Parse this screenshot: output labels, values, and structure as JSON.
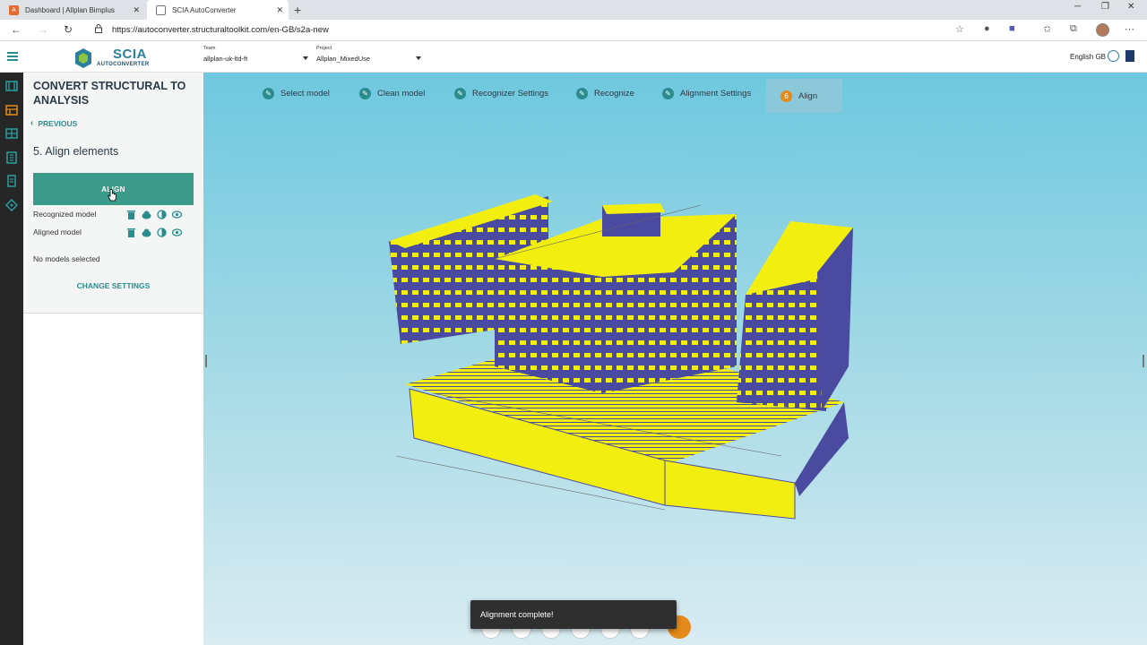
{
  "browser": {
    "tabs": [
      {
        "title": "Dashboard | Allplan Bimplus",
        "favicon": "A"
      },
      {
        "title": "SCIA AutoConverter"
      }
    ],
    "url": "https://autoconverter.structuraltoolkit.com/en-GB/s2a-new"
  },
  "header": {
    "logo_text": "SCIA",
    "logo_sub": "AUTOCONVERTER",
    "team_label": "Team",
    "team_value": "allplan-uk-ltd-ft",
    "project_label": "Project",
    "project_value": "Allplan_MixedUse",
    "language": "English GB"
  },
  "panel": {
    "title": "CONVERT STRUCTURAL TO ANALYSIS",
    "previous_label": "PREVIOUS",
    "step_title": "5.  Align elements",
    "align_button": "ALIGN",
    "models": [
      {
        "label": "Recognized model"
      },
      {
        "label": "Aligned model"
      }
    ],
    "no_models": "No models selected",
    "change_settings": "CHANGE SETTINGS"
  },
  "stepper": {
    "steps": [
      {
        "label": "Select model",
        "state": "done"
      },
      {
        "label": "Clean model",
        "state": "done"
      },
      {
        "label": "Recognizer Settings",
        "state": "done"
      },
      {
        "label": "Recognize",
        "state": "done"
      },
      {
        "label": "Alignment Settings",
        "state": "done"
      },
      {
        "label": "Align",
        "number": "6",
        "state": "current"
      }
    ]
  },
  "toast": {
    "message": "Alignment complete!"
  },
  "colors": {
    "accent": "#2a8c8c",
    "button": "#3b9a8a",
    "current_step": "#e58a1a",
    "model_fill": "#f2ef10",
    "model_wall": "#4a4aa0"
  }
}
